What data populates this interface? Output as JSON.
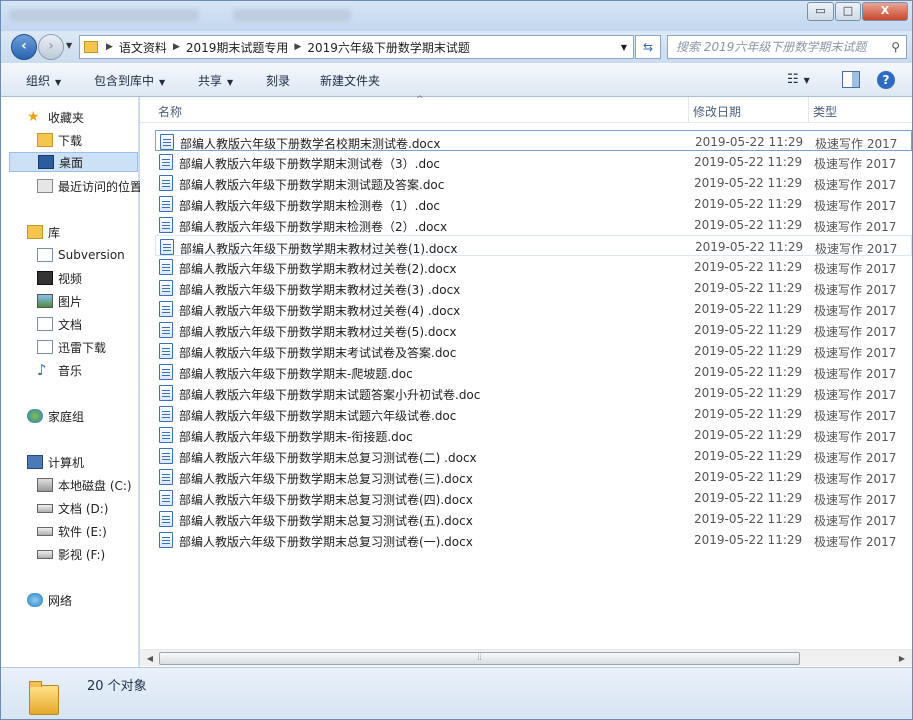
{
  "window": {
    "minimize": "▭",
    "maximize": "□",
    "close": "X"
  },
  "address": {
    "segments": [
      "语文资料",
      "2019期末试题专用",
      "2019六年级下册数学期末试题"
    ],
    "search_placeholder": "搜索 2019六年级下册数学期末试题"
  },
  "toolbar": {
    "organize": "组织",
    "include": "包含到库中",
    "share": "共享",
    "burn": "刻录",
    "new_folder": "新建文件夹"
  },
  "nav": {
    "favorites": "收藏夹",
    "downloads": "下载",
    "desktop": "桌面",
    "recent": "最近访问的位置",
    "libraries": "库",
    "subversion": "Subversion",
    "videos": "视频",
    "pictures": "图片",
    "documents": "文档",
    "thunder": "迅雷下载",
    "music": "音乐",
    "homegroup": "家庭组",
    "computer": "计算机",
    "drive_c": "本地磁盘 (C:)",
    "drive_d": "文档 (D:)",
    "drive_e": "软件 (E:)",
    "drive_f": "影视 (F:)",
    "network": "网络"
  },
  "columns": {
    "name": "名称",
    "date": "修改日期",
    "type": "类型"
  },
  "files": [
    {
      "name": "部编人教版六年级下册数学名校期末测试卷.docx",
      "date": "2019-05-22 11:29",
      "type": "极速写作 2017"
    },
    {
      "name": "部编人教版六年级下册数学期末测试卷（3）.doc",
      "date": "2019-05-22 11:29",
      "type": "极速写作 2017"
    },
    {
      "name": "部编人教版六年级下册数学期末测试题及答案.doc",
      "date": "2019-05-22 11:29",
      "type": "极速写作 2017"
    },
    {
      "name": "部编人教版六年级下册数学期末检测卷（1）.doc",
      "date": "2019-05-22 11:29",
      "type": "极速写作 2017"
    },
    {
      "name": "部编人教版六年级下册数学期末检测卷（2）.docx",
      "date": "2019-05-22 11:29",
      "type": "极速写作 2017"
    },
    {
      "name": "部编人教版六年级下册数学期末教材过关卷(1).docx",
      "date": "2019-05-22 11:29",
      "type": "极速写作 2017"
    },
    {
      "name": "部编人教版六年级下册数学期末教材过关卷(2).docx",
      "date": "2019-05-22 11:29",
      "type": "极速写作 2017"
    },
    {
      "name": "部编人教版六年级下册数学期末教材过关卷(3) .docx",
      "date": "2019-05-22 11:29",
      "type": "极速写作 2017"
    },
    {
      "name": "部编人教版六年级下册数学期末教材过关卷(4) .docx",
      "date": "2019-05-22 11:29",
      "type": "极速写作 2017"
    },
    {
      "name": "部编人教版六年级下册数学期末教材过关卷(5).docx",
      "date": "2019-05-22 11:29",
      "type": "极速写作 2017"
    },
    {
      "name": "部编人教版六年级下册数学期末考试试卷及答案.doc",
      "date": "2019-05-22 11:29",
      "type": "极速写作 2017"
    },
    {
      "name": "部编人教版六年级下册数学期末-爬坡题.doc",
      "date": "2019-05-22 11:29",
      "type": "极速写作 2017"
    },
    {
      "name": "部编人教版六年级下册数学期末试题答案小升初试卷.doc",
      "date": "2019-05-22 11:29",
      "type": "极速写作 2017"
    },
    {
      "name": "部编人教版六年级下册数学期末试题六年级试卷.doc",
      "date": "2019-05-22 11:29",
      "type": "极速写作 2017"
    },
    {
      "name": "部编人教版六年级下册数学期末-衔接题.doc",
      "date": "2019-05-22 11:29",
      "type": "极速写作 2017"
    },
    {
      "name": "部编人教版六年级下册数学期末总复习测试卷(二) .docx",
      "date": "2019-05-22 11:29",
      "type": "极速写作 2017"
    },
    {
      "name": "部编人教版六年级下册数学期末总复习测试卷(三).docx",
      "date": "2019-05-22 11:29",
      "type": "极速写作 2017"
    },
    {
      "name": "部编人教版六年级下册数学期末总复习测试卷(四).docx",
      "date": "2019-05-22 11:29",
      "type": "极速写作 2017"
    },
    {
      "name": "部编人教版六年级下册数学期末总复习测试卷(五).docx",
      "date": "2019-05-22 11:29",
      "type": "极速写作 2017"
    },
    {
      "name": "部编人教版六年级下册数学期末总复习测试卷(一).docx",
      "date": "2019-05-22 11:29",
      "type": "极速写作 2017"
    }
  ],
  "status": {
    "count": "20 个对象"
  }
}
